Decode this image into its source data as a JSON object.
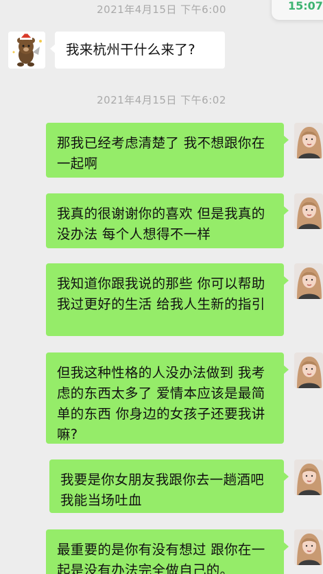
{
  "status": {
    "clock": "15:07"
  },
  "timestamps": [
    "2021年4月15日 下午6:00",
    "2021年4月15日 下午6:02"
  ],
  "messages": {
    "incoming_1": "我来杭州干什么来了?",
    "outgoing_1": "那我已经考虑清楚了 我不想跟你在一起啊",
    "outgoing_2": "我真的很谢谢你的喜欢 但是我真的没办法 每个人想得不一样",
    "outgoing_3": "我知道你跟我说的那些 你可以帮助我过更好的生活 给我人生新的指引",
    "outgoing_4": "但我这种性格的人没办法做到 我考虑的东西太多了 爱情本应该是最简单的东西 你身边的女孩子还要我讲嘛?",
    "outgoing_5": "我要是你女朋友我跟你去一趟酒吧我能当场吐血",
    "outgoing_6": "最重要的是你有没有想过 跟你在一起是没有办法完全做自己的。"
  },
  "colors": {
    "background": "#ededed",
    "outgoing_bubble": "#95ec69",
    "incoming_bubble": "#ffffff",
    "timestamp_text": "#a9a9a9",
    "clock_text": "#3cb371"
  },
  "icons": {
    "incoming_avatar": "cartoon-bear-avatar",
    "outgoing_avatar": "woman-portrait-avatar"
  }
}
